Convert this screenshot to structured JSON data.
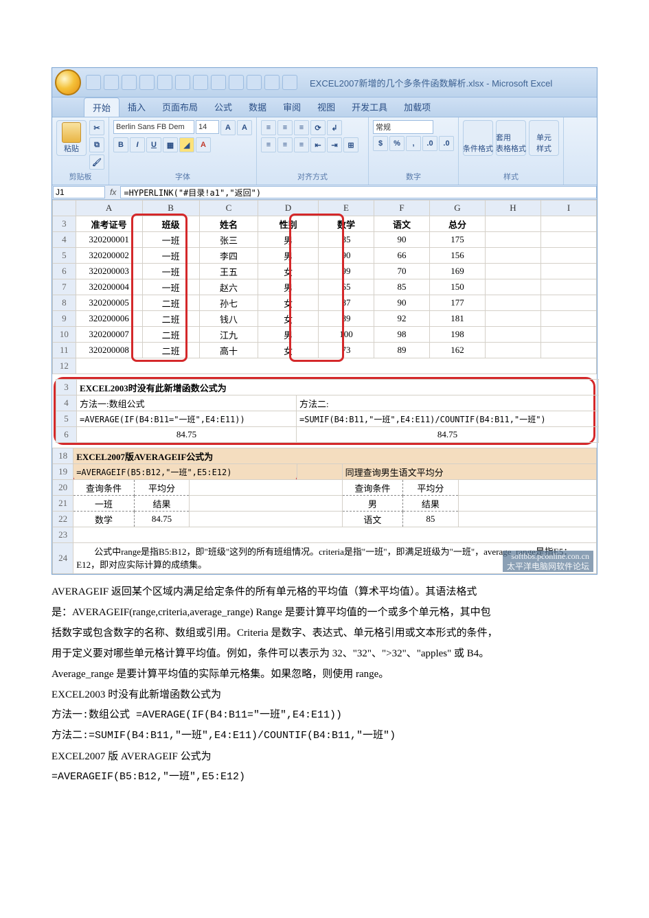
{
  "titlebar": {
    "title": "EXCEL2007新增的几个多条件函数解析.xlsx - Microsoft Excel"
  },
  "ribbon": {
    "tabs": [
      "开始",
      "插入",
      "页面布局",
      "公式",
      "数据",
      "审阅",
      "视图",
      "开发工具",
      "加载项"
    ],
    "paste": "粘贴",
    "groups": {
      "clipboard": "剪贴板",
      "font": "字体",
      "align": "对齐方式",
      "number": "数字",
      "style": "样式"
    },
    "font_name": "Berlin Sans FB Dem",
    "font_size": "14",
    "number_format": "常规",
    "cond": "条件格式",
    "套用": "套用\n表格格式",
    "cell": "单元\n样式"
  },
  "namebox": "J1",
  "formula": "=HYPERLINK(\"#目录!a1\",\"返回\")",
  "columns": [
    "",
    "A",
    "B",
    "C",
    "D",
    "E",
    "F",
    "G",
    "H",
    "I"
  ],
  "table": {
    "headers": [
      "准考证号",
      "班级",
      "姓名",
      "性别",
      "数学",
      "语文",
      "总分"
    ],
    "rows": [
      [
        "320200001",
        "一班",
        "张三",
        "男",
        "85",
        "90",
        "175"
      ],
      [
        "320200002",
        "一班",
        "李四",
        "男",
        "90",
        "66",
        "156"
      ],
      [
        "320200003",
        "一班",
        "王五",
        "女",
        "99",
        "70",
        "169"
      ],
      [
        "320200004",
        "一班",
        "赵六",
        "男",
        "65",
        "85",
        "150"
      ],
      [
        "320200005",
        "二班",
        "孙七",
        "女",
        "87",
        "90",
        "177"
      ],
      [
        "320200006",
        "二班",
        "钱八",
        "女",
        "89",
        "92",
        "181"
      ],
      [
        "320200007",
        "二班",
        "江九",
        "男",
        "100",
        "98",
        "198"
      ],
      [
        "320200008",
        "二班",
        "高十",
        "女",
        "73",
        "89",
        "162"
      ]
    ],
    "row_indices": [
      "3",
      "4",
      "5",
      "6",
      "7",
      "8",
      "9",
      "10",
      "11",
      "12"
    ]
  },
  "section2": {
    "title": "EXCEL2003时没有此新增函数公式为",
    "m1_label": "方法一:数组公式",
    "m1_formula": "=AVERAGE(IF(B4:B11=\"一班\",E4:E11))",
    "m1_result": "84.75",
    "m2_label": "方法二:",
    "m2_formula": "=SUMIF(B4:B11,\"一班\",E4:E11)/COUNTIF(B4:B11,\"一班\")",
    "m2_result": "84.75",
    "row_indices": [
      "3",
      "4",
      "5",
      "6"
    ]
  },
  "section3": {
    "title": "EXCEL2007版AVERAGEIF公式为",
    "formula": "=AVERAGEIF(B5:B12,\"一班\",E5:E12)",
    "right_title": "同理查询男生语文平均分",
    "left_box": {
      "h1": "查询条件",
      "h2": "平均分",
      "r1": "一班",
      "r2": "结果",
      "r3": "数学",
      "r4": "84.75"
    },
    "right_box": {
      "h1": "查询条件",
      "h2": "平均分",
      "r1": "男",
      "r2": "结果",
      "r3": "语文",
      "r4": "85"
    },
    "row_indices": [
      "18",
      "19",
      "20",
      "21",
      "22",
      "23",
      "24"
    ],
    "note": "　　公式中range是指B5:B12，即\"班级\"这列的所有班组情况。criteria是指\"一班\"，即满足班级为\"一班\"，average_range是指E5：E12，即对应实际计算的成绩集。"
  },
  "watermark": {
    "l1": "softbbs.pconline.con.cn",
    "l2": "太平洋电脑网软件论坛"
  },
  "doc": {
    "p1": "AVERAGEIF 返回某个区域内满足给定条件的所有单元格的平均值（算术平均值）。其语法格式",
    "p2": "是：AVERAGEIF(range,criteria,average_range) Range 是要计算平均值的一个或多个单元格，其中包",
    "p3": "括数字或包含数字的名称、数组或引用。Criteria  是数字、表达式、单元格引用或文本形式的条件，",
    "p4": "用于定义要对哪些单元格计算平均值。例如，条件可以表示为 32、\"32\"、\">32\"、\"apples\" 或 B4。",
    "p5": "Average_range  是要计算平均值的实际单元格集。如果忽略，则使用 range。",
    "p6": "EXCEL2003 时没有此新增函数公式为",
    "p7": "方法一:数组公式 =AVERAGE(IF(B4:B11=\"一班\",E4:E11))",
    "p8": "方法二:=SUMIF(B4:B11,\"一班\",E4:E11)/COUNTIF(B4:B11,\"一班\")",
    "p9": "EXCEL2007 版 AVERAGEIF 公式为",
    "p10": "=AVERAGEIF(B5:B12,\"一班\",E5:E12)"
  }
}
